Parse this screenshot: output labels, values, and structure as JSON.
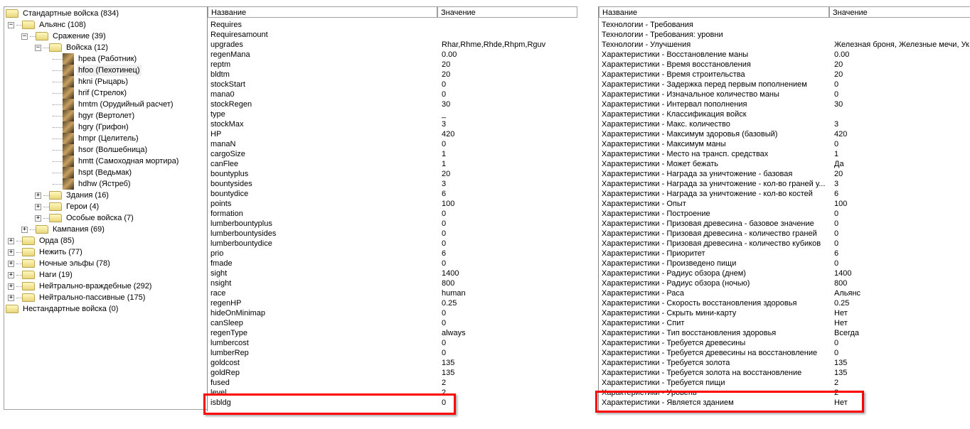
{
  "tree": [
    {
      "label": "Стандартные войска (834)",
      "level": 0,
      "exp": "",
      "type": "folder"
    },
    {
      "label": "Альянс (108)",
      "level": 1,
      "exp": "−",
      "type": "folder"
    },
    {
      "label": "Сражение (39)",
      "level": 2,
      "exp": "−",
      "type": "folder"
    },
    {
      "label": "Войска (12)",
      "level": 3,
      "exp": "−",
      "type": "folder"
    },
    {
      "label": "hpea (Работник)",
      "level": 4,
      "exp": "",
      "type": "unit"
    },
    {
      "label": "hfoo (Пехотинец)",
      "level": 4,
      "exp": "",
      "type": "unit",
      "selected": true
    },
    {
      "label": "hkni (Рыцарь)",
      "level": 4,
      "exp": "",
      "type": "unit"
    },
    {
      "label": "hrif (Стрелок)",
      "level": 4,
      "exp": "",
      "type": "unit"
    },
    {
      "label": "hmtm (Орудийный расчет)",
      "level": 4,
      "exp": "",
      "type": "unit"
    },
    {
      "label": "hgyr (Вертолет)",
      "level": 4,
      "exp": "",
      "type": "unit"
    },
    {
      "label": "hgry (Грифон)",
      "level": 4,
      "exp": "",
      "type": "unit"
    },
    {
      "label": "hmpr (Целитель)",
      "level": 4,
      "exp": "",
      "type": "unit"
    },
    {
      "label": "hsor (Волшебница)",
      "level": 4,
      "exp": "",
      "type": "unit"
    },
    {
      "label": "hmtt (Самоходная мортира)",
      "level": 4,
      "exp": "",
      "type": "unit"
    },
    {
      "label": "hspt (Ведьмак)",
      "level": 4,
      "exp": "",
      "type": "unit"
    },
    {
      "label": "hdhw (Ястреб)",
      "level": 4,
      "exp": "",
      "type": "unit"
    },
    {
      "label": "Здания (16)",
      "level": 3,
      "exp": "+",
      "type": "folder"
    },
    {
      "label": "Герои (4)",
      "level": 3,
      "exp": "+",
      "type": "folder"
    },
    {
      "label": "Особые войска (7)",
      "level": 3,
      "exp": "+",
      "type": "folder"
    },
    {
      "label": "Кампания (69)",
      "level": 2,
      "exp": "+",
      "type": "folder"
    },
    {
      "label": "Орда (85)",
      "level": 1,
      "exp": "+",
      "type": "folder"
    },
    {
      "label": "Нежить (77)",
      "level": 1,
      "exp": "+",
      "type": "folder"
    },
    {
      "label": "Ночные эльфы (78)",
      "level": 1,
      "exp": "+",
      "type": "folder"
    },
    {
      "label": "Наги (19)",
      "level": 1,
      "exp": "+",
      "type": "folder"
    },
    {
      "label": "Нейтрально-враждебные (292)",
      "level": 1,
      "exp": "+",
      "type": "folder"
    },
    {
      "label": "Нейтрально-пассивные (175)",
      "level": 1,
      "exp": "+",
      "type": "folder"
    },
    {
      "label": "Нестандартные войска (0)",
      "level": 0,
      "exp": "",
      "type": "folder"
    }
  ],
  "raw_grid": {
    "col_name": "Название",
    "col_value": "Значение",
    "rows": [
      [
        "Requires",
        ""
      ],
      [
        "Requiresamount",
        ""
      ],
      [
        "upgrades",
        "Rhar,Rhme,Rhde,Rhpm,Rguv"
      ],
      [
        "regenMana",
        "0.00"
      ],
      [
        "reptm",
        "20"
      ],
      [
        "bldtm",
        "20"
      ],
      [
        "stockStart",
        "0"
      ],
      [
        "mana0",
        "0"
      ],
      [
        "stockRegen",
        "30"
      ],
      [
        "type",
        "_"
      ],
      [
        "stockMax",
        "3"
      ],
      [
        "HP",
        "420"
      ],
      [
        "manaN",
        "0"
      ],
      [
        "cargoSize",
        "1"
      ],
      [
        "canFlee",
        "1"
      ],
      [
        "bountyplus",
        "20"
      ],
      [
        "bountysides",
        "3"
      ],
      [
        "bountydice",
        "6"
      ],
      [
        "points",
        "100"
      ],
      [
        "formation",
        "0"
      ],
      [
        "lumberbountyplus",
        "0"
      ],
      [
        "lumberbountysides",
        "0"
      ],
      [
        "lumberbountydice",
        "0"
      ],
      [
        "prio",
        "6"
      ],
      [
        "fmade",
        "0"
      ],
      [
        "sight",
        "1400"
      ],
      [
        "nsight",
        "800"
      ],
      [
        "race",
        "human"
      ],
      [
        "regenHP",
        "0.25"
      ],
      [
        "hideOnMinimap",
        "0"
      ],
      [
        "canSleep",
        "0"
      ],
      [
        "regenType",
        "always"
      ],
      [
        "lumbercost",
        "0"
      ],
      [
        "lumberRep",
        "0"
      ],
      [
        "goldcost",
        "135"
      ],
      [
        "goldRep",
        "135"
      ],
      [
        "fused",
        "2"
      ],
      [
        "level",
        "2"
      ],
      [
        "isbldg",
        "0"
      ]
    ]
  },
  "named_grid": {
    "col_name": "Название",
    "col_value": "Значение",
    "rows": [
      [
        "Технологии - Требования",
        ""
      ],
      [
        "Технологии - Требования: уровни",
        ""
      ],
      [
        "Технологии - Улучшения",
        "Железная броня, Железные мечи, Ук"
      ],
      [
        "Характеристики - Восстановление маны",
        "0.00"
      ],
      [
        "Характеристики - Время восстановления",
        "20"
      ],
      [
        "Характеристики - Время строительства",
        "20"
      ],
      [
        "Характеристики - Задержка перед первым пополнением",
        "0"
      ],
      [
        "Характеристики - Изначальное количество маны",
        "0"
      ],
      [
        "Характеристики - Интервал пополнения",
        "30"
      ],
      [
        "Характеристики - Классификация войск",
        ""
      ],
      [
        "Характеристики - Макс. количество",
        "3"
      ],
      [
        "Характеристики - Максимум здоровья (базовый)",
        "420"
      ],
      [
        "Характеристики - Максимум маны",
        "0"
      ],
      [
        "Характеристики - Место на трансп. средствах",
        "1"
      ],
      [
        "Характеристики - Может бежать",
        "Да"
      ],
      [
        "Характеристики - Награда за уничтожение - базовая",
        "20"
      ],
      [
        "Характеристики - Награда за уничтожение - кол-во граней у...",
        "3"
      ],
      [
        "Характеристики - Награда за уничтожение - кол-во костей",
        "6"
      ],
      [
        "Характеристики - Опыт",
        "100"
      ],
      [
        "Характеристики - Построение",
        "0"
      ],
      [
        "Характеристики - Призовая древесина - базовое значение",
        "0"
      ],
      [
        "Характеристики - Призовая древесина - количество граней",
        "0"
      ],
      [
        "Характеристики - Призовая древесина - количество кубиков",
        "0"
      ],
      [
        "Характеристики - Приоритет",
        "6"
      ],
      [
        "Характеристики - Произведено пищи",
        "0"
      ],
      [
        "Характеристики - Радиус обзора (днем)",
        "1400"
      ],
      [
        "Характеристики - Радиус обзора (ночью)",
        "800"
      ],
      [
        "Характеристики - Раса",
        "Альянс"
      ],
      [
        "Характеристики - Скорость восстановления здоровья",
        "0.25"
      ],
      [
        "Характеристики - Скрыть мини-карту",
        "Нет"
      ],
      [
        "Характеристики - Спит",
        "Нет"
      ],
      [
        "Характеристики - Тип восстановления здоровья",
        "Всегда"
      ],
      [
        "Характеристики - Требуется древесины",
        "0"
      ],
      [
        "Характеристики - Требуется древесины на восстановление",
        "0"
      ],
      [
        "Характеристики - Требуется золота",
        "135"
      ],
      [
        "Характеристики - Требуется золота на восстановление",
        "135"
      ],
      [
        "Характеристики - Требуется пищи",
        "2"
      ],
      [
        "Характеристики - Уровень",
        "2"
      ],
      [
        "Характеристики - Является зданием",
        "Нет"
      ]
    ]
  },
  "colors": {
    "highlight": "#ff0000"
  }
}
